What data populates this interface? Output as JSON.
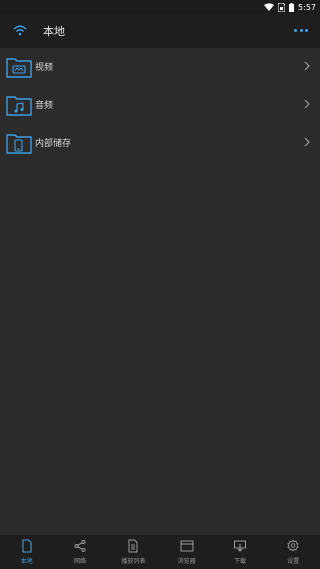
{
  "status_bar": {
    "time": "5:57"
  },
  "app_bar": {
    "title": "本地"
  },
  "folders": [
    {
      "label": "视频",
      "icon": "video-folder-icon"
    },
    {
      "label": "音频",
      "icon": "music-folder-icon"
    },
    {
      "label": "内部储存",
      "icon": "storage-folder-icon"
    }
  ],
  "bottom_nav": [
    {
      "label": "本地",
      "icon": "file-icon",
      "active": true
    },
    {
      "label": "网络",
      "icon": "share-icon",
      "active": false
    },
    {
      "label": "播放列表",
      "icon": "playlist-icon",
      "active": false
    },
    {
      "label": "浏览器",
      "icon": "browser-icon",
      "active": false
    },
    {
      "label": "下载",
      "icon": "download-icon",
      "active": false
    },
    {
      "label": "设置",
      "icon": "gear-icon",
      "active": false
    }
  ],
  "colors": {
    "accent": "#3aa0e8",
    "background": "#2b2b2b",
    "bar": "#1e1e1e"
  }
}
